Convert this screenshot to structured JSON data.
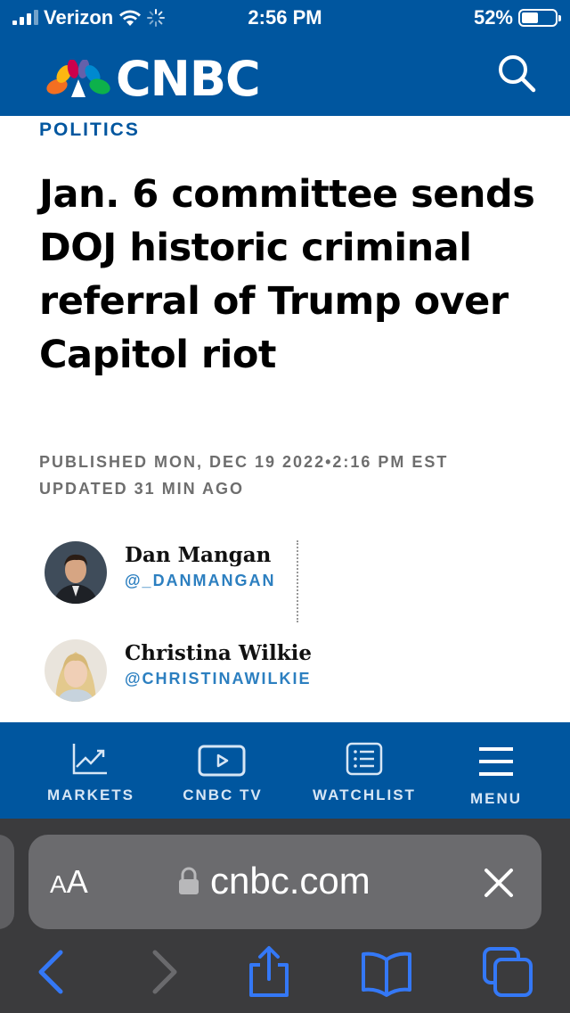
{
  "status_bar": {
    "carrier": "Verizon",
    "time": "2:56 PM",
    "battery": "52%"
  },
  "header": {
    "logo": "CNBC"
  },
  "article": {
    "section": "POLITICS",
    "headline": "Jan. 6 committee sends DOJ historic criminal referral of Trump over Capitol riot",
    "published": "PUBLISHED MON, DEC 19 2022•2:16 PM EST",
    "updated": "UPDATED 31 MIN AGO",
    "authors": [
      {
        "name": "Dan Mangan",
        "handle": "@_DANMANGAN"
      },
      {
        "name": "Christina Wilkie",
        "handle": "@CHRISTINAWILKIE"
      }
    ]
  },
  "tabbar": {
    "items": [
      {
        "label": "MARKETS",
        "icon": "chart-icon"
      },
      {
        "label": "CNBC TV",
        "icon": "play-icon"
      },
      {
        "label": "WATCHLIST",
        "icon": "list-icon"
      },
      {
        "label": "MENU",
        "icon": "hamburger-icon"
      }
    ]
  },
  "browser": {
    "text_size_label_small": "A",
    "text_size_label_large": "A",
    "url": "cnbc.com"
  },
  "colors": {
    "brand": "#00569f",
    "handle": "#2c7fc0",
    "safari_bg": "#3b3b3d",
    "ios_blue": "#3478f6"
  }
}
